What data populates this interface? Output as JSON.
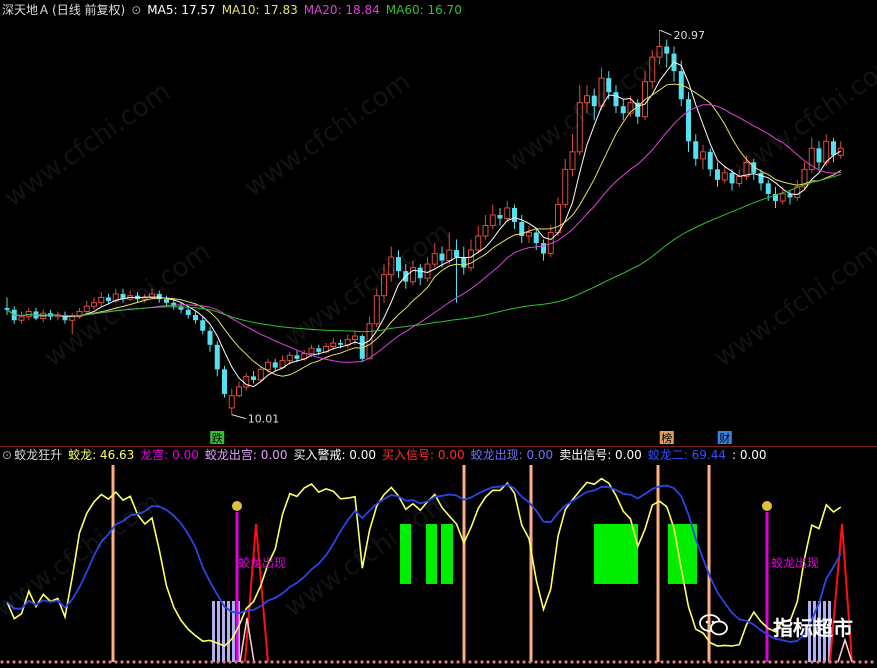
{
  "colors": {
    "up": "#e04a3a",
    "down": "#55e0f0",
    "ma5": "#ffffff",
    "ma10": "#e8e060",
    "ma20": "#e040e0",
    "ma60": "#30c030",
    "jlkw": "#ffff66",
    "jl2": "#2a44e8",
    "jingbao": "#ffb080",
    "buy": "#e000e0",
    "green": "#00ee00",
    "lav": "#b0b0f0",
    "sig": "#ff1010"
  },
  "main_header": {
    "stock": "深天地Ａ",
    "period": "(日线 前复权)",
    "ma5": "MA5: 17.57",
    "ma10": "MA10: 17.83",
    "ma20": "MA20: 18.84",
    "ma60": "MA60: 16.70"
  },
  "sub_header": {
    "name": "蛟龙狂升",
    "jl": "蛟龙: 46.63",
    "lg": "龙宫: 0.00",
    "jlcg": "蛟龙出宫: 0.00",
    "mrjj": "买入警戒: 0.00",
    "mrxh": "买入信号: 0.00",
    "jlcx": "蛟龙出现: 0.00",
    "mcxh": "卖出信号: 0.00",
    "jl2": "蛟龙二: 69.44",
    "extra": ": 0.00"
  },
  "markers": {
    "die": "跌",
    "bang": "榜",
    "cai": "财"
  },
  "annotations": {
    "high": "20.97",
    "low": "10.01",
    "jlcx": "蛟龙出现"
  },
  "watermark": "www.cfchi.com",
  "logo": "指标超市",
  "chart_data": {
    "type": "candlestick",
    "title": "深天地Ａ",
    "price_max": 20.97,
    "price_min": 10.01,
    "candles": [
      [
        13.05,
        13.0,
        13.35,
        12.85
      ],
      [
        13.0,
        12.7,
        13.1,
        12.6
      ],
      [
        12.7,
        12.8,
        12.95,
        12.6
      ],
      [
        12.8,
        12.95,
        13.05,
        12.7
      ],
      [
        12.95,
        12.75,
        13.05,
        12.7
      ],
      [
        12.75,
        12.9,
        13.0,
        12.65
      ],
      [
        12.9,
        12.8,
        13.0,
        12.7
      ],
      [
        12.8,
        12.85,
        12.95,
        12.7
      ],
      [
        12.85,
        12.7,
        12.95,
        12.6
      ],
      [
        12.7,
        12.8,
        12.9,
        12.3
      ],
      [
        12.8,
        12.95,
        13.05,
        12.75
      ],
      [
        12.95,
        13.1,
        13.25,
        12.9
      ],
      [
        13.1,
        13.2,
        13.35,
        13.0
      ],
      [
        13.2,
        13.35,
        13.5,
        13.1
      ],
      [
        13.35,
        13.25,
        13.45,
        13.15
      ],
      [
        13.25,
        13.45,
        13.6,
        13.2
      ],
      [
        13.45,
        13.3,
        13.6,
        13.2
      ],
      [
        13.3,
        13.4,
        13.55,
        13.25
      ],
      [
        13.4,
        13.3,
        13.5,
        13.2
      ],
      [
        13.3,
        13.35,
        13.45,
        13.2
      ],
      [
        13.35,
        13.45,
        13.6,
        13.3
      ],
      [
        13.45,
        13.3,
        13.55,
        13.2
      ],
      [
        13.3,
        13.2,
        13.4,
        13.1
      ],
      [
        13.2,
        13.1,
        13.3,
        13.0
      ],
      [
        13.1,
        13.0,
        13.2,
        12.9
      ],
      [
        13.0,
        12.85,
        13.1,
        12.75
      ],
      [
        12.85,
        12.7,
        12.95,
        12.6
      ],
      [
        12.7,
        12.4,
        12.8,
        12.3
      ],
      [
        12.4,
        12.0,
        12.5,
        11.8
      ],
      [
        12.0,
        11.3,
        12.1,
        11.1
      ],
      [
        11.3,
        10.6,
        11.4,
        10.5
      ],
      [
        10.2,
        10.55,
        10.75,
        10.01
      ],
      [
        10.55,
        10.8,
        10.95,
        10.5
      ],
      [
        10.8,
        11.1,
        11.2,
        10.7
      ],
      [
        11.1,
        11.0,
        11.25,
        10.9
      ],
      [
        11.0,
        11.3,
        11.4,
        10.95
      ],
      [
        11.3,
        11.5,
        11.6,
        11.2
      ],
      [
        11.5,
        11.35,
        11.6,
        11.25
      ],
      [
        11.35,
        11.55,
        11.7,
        11.3
      ],
      [
        11.55,
        11.7,
        11.8,
        11.45
      ],
      [
        11.7,
        11.6,
        11.85,
        11.5
      ],
      [
        11.6,
        11.75,
        11.85,
        11.55
      ],
      [
        11.75,
        11.9,
        12.0,
        11.65
      ],
      [
        11.9,
        11.8,
        12.0,
        11.7
      ],
      [
        11.8,
        11.95,
        12.05,
        11.75
      ],
      [
        11.95,
        12.05,
        12.2,
        11.85
      ],
      [
        12.05,
        12.0,
        12.15,
        11.9
      ],
      [
        12.0,
        12.15,
        12.3,
        11.9
      ],
      [
        12.15,
        12.25,
        12.4,
        12.0
      ],
      [
        12.25,
        11.6,
        12.3,
        11.5
      ],
      [
        11.6,
        12.6,
        12.8,
        11.6
      ],
      [
        12.6,
        13.4,
        13.6,
        12.5
      ],
      [
        13.4,
        14.0,
        14.3,
        13.2
      ],
      [
        14.0,
        14.5,
        14.8,
        13.8
      ],
      [
        14.5,
        14.1,
        14.7,
        13.9
      ],
      [
        14.1,
        13.8,
        14.3,
        13.6
      ],
      [
        13.8,
        14.2,
        14.4,
        13.7
      ],
      [
        14.2,
        13.9,
        14.3,
        13.7
      ],
      [
        13.9,
        14.3,
        14.5,
        13.8
      ],
      [
        14.3,
        14.6,
        14.9,
        14.2
      ],
      [
        14.6,
        14.4,
        14.8,
        14.2
      ],
      [
        14.4,
        14.7,
        15.2,
        14.3
      ],
      [
        14.7,
        14.5,
        15.0,
        13.2
      ],
      [
        14.5,
        14.2,
        14.8,
        14.0
      ],
      [
        14.2,
        14.7,
        15.0,
        14.1
      ],
      [
        14.7,
        15.1,
        15.4,
        14.6
      ],
      [
        15.1,
        15.4,
        15.7,
        15.0
      ],
      [
        15.4,
        15.7,
        16.0,
        15.3
      ],
      [
        15.7,
        15.6,
        15.9,
        15.4
      ],
      [
        15.6,
        15.9,
        16.1,
        15.5
      ],
      [
        15.9,
        15.5,
        16.0,
        15.3
      ],
      [
        15.5,
        15.1,
        15.7,
        14.9
      ],
      [
        15.1,
        15.2,
        15.4,
        14.9
      ],
      [
        15.2,
        14.9,
        15.3,
        14.7
      ],
      [
        14.9,
        14.6,
        15.0,
        14.4
      ],
      [
        14.6,
        15.2,
        15.4,
        14.5
      ],
      [
        15.2,
        16.0,
        16.2,
        15.1
      ],
      [
        16.0,
        17.0,
        17.3,
        15.9
      ],
      [
        17.0,
        17.5,
        18.0,
        16.8
      ],
      [
        17.5,
        18.9,
        19.4,
        17.4
      ],
      [
        18.9,
        19.1,
        19.4,
        18.6
      ],
      [
        19.1,
        18.8,
        19.3,
        18.4
      ],
      [
        18.8,
        19.6,
        19.9,
        18.7
      ],
      [
        19.6,
        19.2,
        19.8,
        19.0
      ],
      [
        19.2,
        18.8,
        19.4,
        18.6
      ],
      [
        18.8,
        18.6,
        19.0,
        18.4
      ],
      [
        18.6,
        18.9,
        19.1,
        18.5
      ],
      [
        18.9,
        18.5,
        19.0,
        18.3
      ],
      [
        18.5,
        19.5,
        19.8,
        18.4
      ],
      [
        19.5,
        20.2,
        20.4,
        19.3
      ],
      [
        20.2,
        20.5,
        20.97,
        20.0
      ],
      [
        20.5,
        20.3,
        20.7,
        19.9
      ],
      [
        20.3,
        19.8,
        20.5,
        19.5
      ],
      [
        19.8,
        19.0,
        20.1,
        18.8
      ],
      [
        19.0,
        17.8,
        19.2,
        17.5
      ],
      [
        17.8,
        17.3,
        18.0,
        17.1
      ],
      [
        17.3,
        17.5,
        17.7,
        17.0
      ],
      [
        17.5,
        17.0,
        17.6,
        16.8
      ],
      [
        17.0,
        16.7,
        17.2,
        16.5
      ],
      [
        16.7,
        16.9,
        17.1,
        16.6
      ],
      [
        16.9,
        16.6,
        17.0,
        16.4
      ],
      [
        16.6,
        16.8,
        17.0,
        16.5
      ],
      [
        16.8,
        17.2,
        17.4,
        16.7
      ],
      [
        17.2,
        16.9,
        17.3,
        16.7
      ],
      [
        16.9,
        16.6,
        17.0,
        16.4
      ],
      [
        16.6,
        16.3,
        16.7,
        16.1
      ],
      [
        16.3,
        16.1,
        16.5,
        15.9
      ],
      [
        16.1,
        16.3,
        16.5,
        16.0
      ],
      [
        16.3,
        16.2,
        16.4,
        16.0
      ],
      [
        16.2,
        16.5,
        16.7,
        16.1
      ],
      [
        16.5,
        17.0,
        17.2,
        16.4
      ],
      [
        17.0,
        17.6,
        17.9,
        16.9
      ],
      [
        17.6,
        17.2,
        17.8,
        17.0
      ],
      [
        17.2,
        17.8,
        18.0,
        17.1
      ],
      [
        17.8,
        17.4,
        17.9,
        17.2
      ],
      [
        17.4,
        17.6,
        17.8,
        17.3
      ]
    ]
  }
}
